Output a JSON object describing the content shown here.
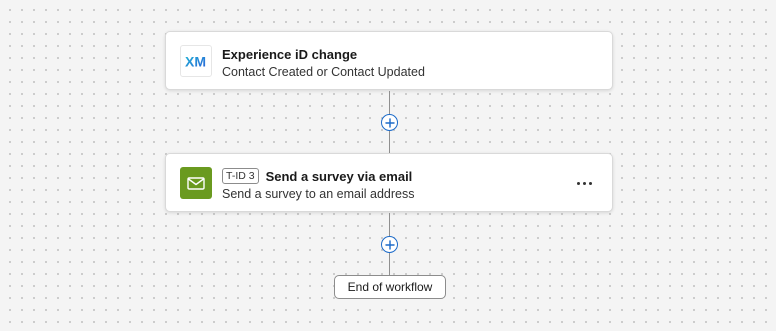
{
  "workflow": {
    "trigger": {
      "icon": "xm-logo-icon",
      "logo_text": "XM",
      "title": "Experience iD change",
      "subtitle": "Contact Created or Contact Updated"
    },
    "add_step_icon": "plus-circle-icon",
    "task": {
      "icon": "envelope-icon",
      "id_badge": "T-ID 3",
      "title": "Send a survey via email",
      "subtitle": "Send a survey to an email address",
      "menu_icon": "more-horizontal-icon"
    },
    "end_label": "End of workflow"
  },
  "colors": {
    "accent_blue": "#1b6ac9",
    "mail_tile_green": "#6a9a1f",
    "connector_gray": "#8f8f8f"
  }
}
